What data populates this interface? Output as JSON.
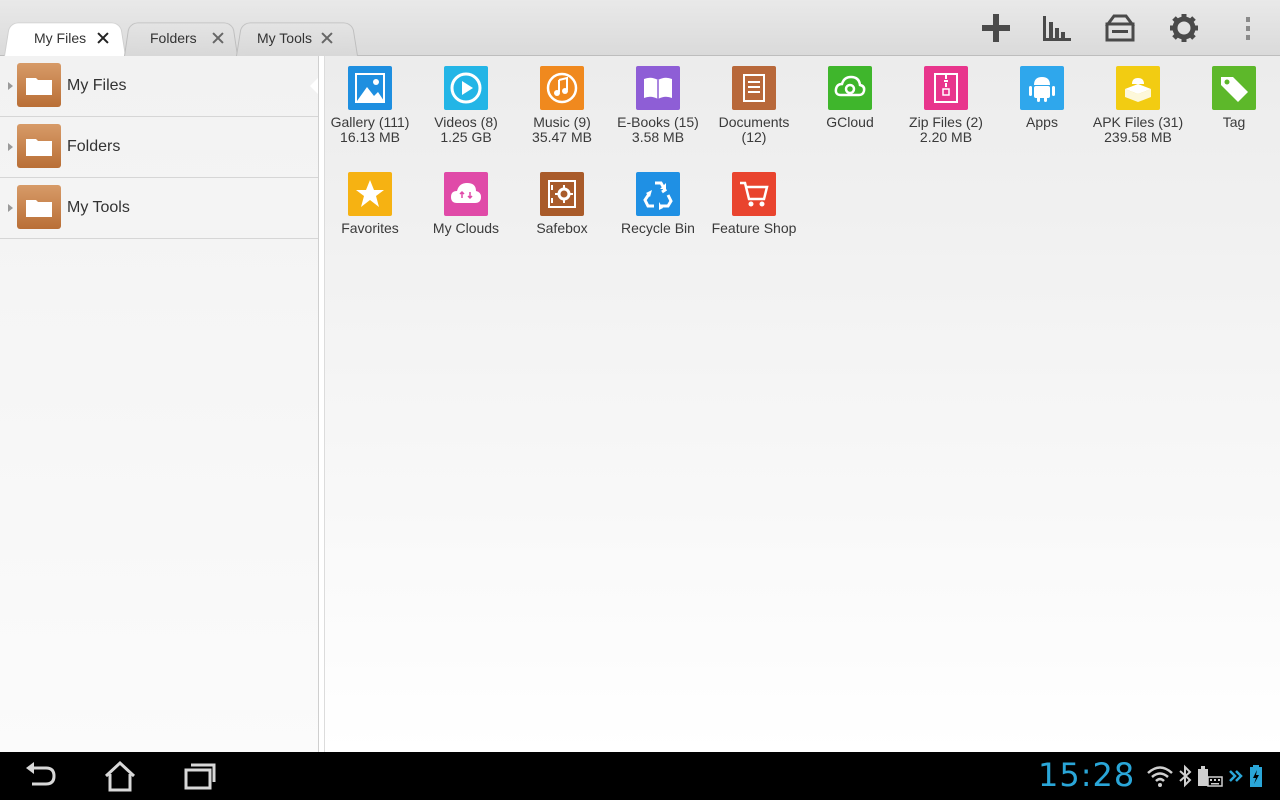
{
  "tabs": [
    {
      "label": "My Files",
      "active": true
    },
    {
      "label": "Folders",
      "active": false
    },
    {
      "label": "My Tools",
      "active": false
    }
  ],
  "toolbar": {
    "icons": [
      "add-icon",
      "analyze-chart-icon",
      "toolbox-icon",
      "settings-gear-icon",
      "overflow-menu-icon"
    ]
  },
  "sidebar": {
    "items": [
      {
        "label": "My Files",
        "icon": "folder-icon"
      },
      {
        "label": "Folders",
        "icon": "folder-icon"
      },
      {
        "label": "My Tools",
        "icon": "folder-icon"
      }
    ]
  },
  "grid": {
    "items": [
      {
        "line1": "Gallery (111)",
        "line2": "16.13 MB",
        "icon": "gallery-icon",
        "color": "#1e8fe0"
      },
      {
        "line1": "Videos (8)",
        "line2": "1.25 GB",
        "icon": "video-play-icon",
        "color": "#23b5e6"
      },
      {
        "line1": "Music (9)",
        "line2": "35.47 MB",
        "icon": "music-note-icon",
        "color": "#f0891e"
      },
      {
        "line1": "E-Books (15)",
        "line2": "3.58 MB",
        "icon": "book-icon",
        "color": "#8e5ed6"
      },
      {
        "line1": "Documents",
        "line2": "(12)",
        "icon": "document-icon",
        "color": "#b8683a"
      },
      {
        "line1": "GCloud",
        "line2": "",
        "icon": "gcloud-icon",
        "color": "#3fb62c"
      },
      {
        "line1": "Zip Files (2)",
        "line2": "2.20 MB",
        "icon": "zip-icon",
        "color": "#e8358c"
      },
      {
        "line1": "Apps",
        "line2": "",
        "icon": "android-icon",
        "color": "#2fa7ec"
      },
      {
        "line1": "APK Files (31)",
        "line2": "239.58 MB",
        "icon": "apk-icon",
        "color": "#f2cc12"
      },
      {
        "line1": "Tag",
        "line2": "",
        "icon": "tag-icon",
        "color": "#5db82a"
      },
      {
        "line1": "Favorites",
        "line2": "",
        "icon": "star-icon",
        "color": "#f6b212"
      },
      {
        "line1": "My Clouds",
        "line2": "",
        "icon": "cloud-icon",
        "color": "#e04aa8"
      },
      {
        "line1": "Safebox",
        "line2": "",
        "icon": "safebox-icon",
        "color": "#a95b2a"
      },
      {
        "line1": "Recycle Bin",
        "line2": "",
        "icon": "recycle-icon",
        "color": "#1f90e4"
      },
      {
        "line1": "Feature Shop",
        "line2": "",
        "icon": "shopping-cart-icon",
        "color": "#e9442e"
      }
    ]
  },
  "systembar": {
    "clock": "15:28",
    "nav": [
      "back-icon",
      "home-icon",
      "recent-apps-icon"
    ],
    "status": [
      "wifi-icon",
      "bluetooth-icon",
      "keyboard-icon",
      "battery-icon"
    ],
    "accent": "#2aa6d8"
  }
}
